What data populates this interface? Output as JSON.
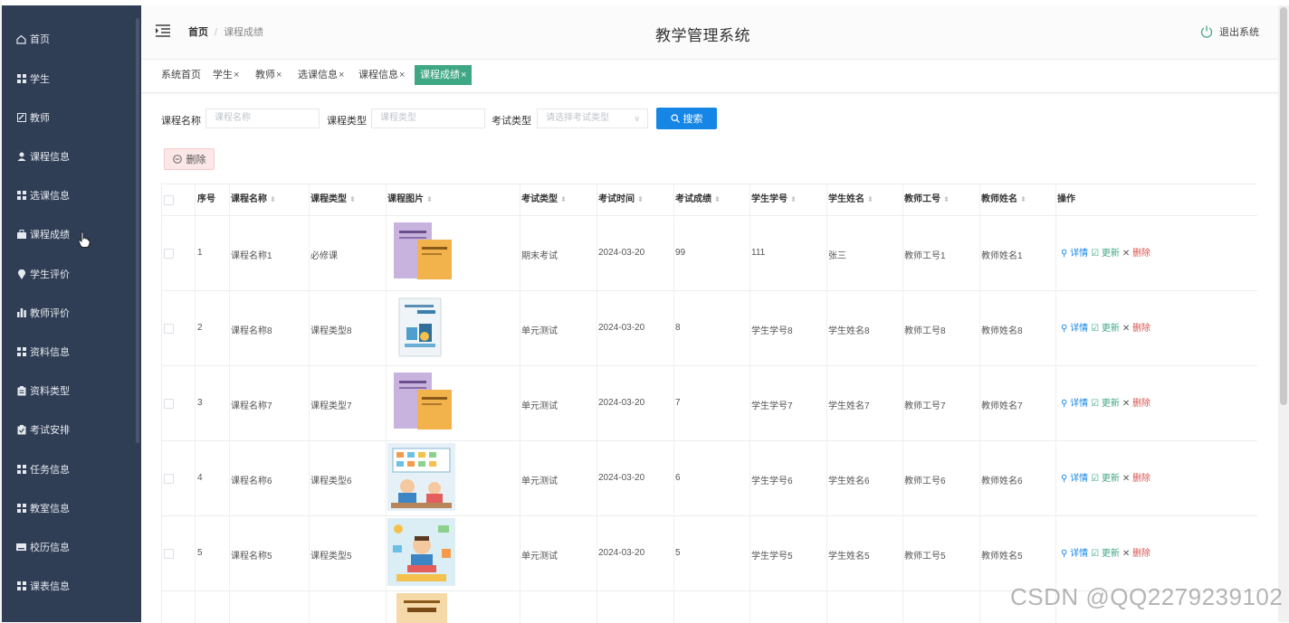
{
  "app_title": "教学管理系统",
  "logout_label": "退出系统",
  "breadcrumb": {
    "home": "首页",
    "current": "课程成绩"
  },
  "sidebar": {
    "items": [
      {
        "label": "首页",
        "icon": "home-icon"
      },
      {
        "label": "学生",
        "icon": "grid-icon"
      },
      {
        "label": "教师",
        "icon": "edit-icon"
      },
      {
        "label": "课程信息",
        "icon": "user-icon"
      },
      {
        "label": "选课信息",
        "icon": "grid-icon"
      },
      {
        "label": "课程成绩",
        "icon": "briefcase-icon"
      },
      {
        "label": "学生评价",
        "icon": "location-icon"
      },
      {
        "label": "教师评价",
        "icon": "bar-chart-icon"
      },
      {
        "label": "资料信息",
        "icon": "grid-icon"
      },
      {
        "label": "资料类型",
        "icon": "clipboard-icon"
      },
      {
        "label": "考试安排",
        "icon": "clipboard-check-icon"
      },
      {
        "label": "任务信息",
        "icon": "grid-icon"
      },
      {
        "label": "教室信息",
        "icon": "grid-icon"
      },
      {
        "label": "校历信息",
        "icon": "keyboard-icon"
      },
      {
        "label": "课表信息",
        "icon": "grid-icon"
      }
    ]
  },
  "tags": [
    {
      "label": "系统首页",
      "closable": false
    },
    {
      "label": "学生",
      "closable": true
    },
    {
      "label": "教师",
      "closable": true
    },
    {
      "label": "选课信息",
      "closable": true
    },
    {
      "label": "课程信息",
      "closable": true
    },
    {
      "label": "课程成绩",
      "closable": true,
      "active": true
    }
  ],
  "tag_close": "×",
  "search": {
    "course_name_label": "课程名称",
    "course_name_placeholder": "课程名称",
    "course_type_label": "课程类型",
    "course_type_placeholder": "课程类型",
    "exam_type_label": "考试类型",
    "exam_type_placeholder": "请选择考试类型",
    "search_button": "搜索"
  },
  "delete_button": "删除",
  "table": {
    "headers": [
      "序号",
      "课程名称",
      "课程类型",
      "课程图片",
      "考试类型",
      "考试时间",
      "考试成绩",
      "学生学号",
      "学生姓名",
      "教师工号",
      "教师姓名",
      "操作"
    ],
    "rows": [
      {
        "index": "1",
        "course_name": "课程名称1",
        "course_type": "必修课",
        "exam_type": "期末考试",
        "exam_time": "2024-03-20",
        "score": "99",
        "student_no": "111",
        "student_name": "张三",
        "teacher_no": "教师工号1",
        "teacher_name": "教师姓名1",
        "image": "book-cover-purple"
      },
      {
        "index": "2",
        "course_name": "课程名称8",
        "course_type": "课程类型8",
        "exam_type": "单元测试",
        "exam_time": "2024-03-20",
        "score": "8",
        "student_no": "学生学号8",
        "student_name": "学生姓名8",
        "teacher_no": "教师工号8",
        "teacher_name": "教师姓名8",
        "image": "book-cover-teal"
      },
      {
        "index": "3",
        "course_name": "课程名称7",
        "course_type": "课程类型7",
        "exam_type": "单元测试",
        "exam_time": "2024-03-20",
        "score": "7",
        "student_no": "学生学号7",
        "student_name": "学生姓名7",
        "teacher_no": "教师工号7",
        "teacher_name": "教师姓名7",
        "image": "book-cover-purple"
      },
      {
        "index": "4",
        "course_name": "课程名称6",
        "course_type": "课程类型6",
        "exam_type": "单元测试",
        "exam_time": "2024-03-20",
        "score": "6",
        "student_no": "学生学号6",
        "student_name": "学生姓名6",
        "teacher_no": "教师工号6",
        "teacher_name": "教师姓名6",
        "image": "classroom-illustration"
      },
      {
        "index": "5",
        "course_name": "课程名称5",
        "course_type": "课程类型5",
        "exam_type": "单元测试",
        "exam_time": "2024-03-20",
        "score": "5",
        "student_no": "学生学号5",
        "student_name": "学生姓名5",
        "teacher_no": "教师工号5",
        "teacher_name": "教师姓名5",
        "image": "reading-illustration"
      }
    ],
    "actions": {
      "detail": "详情",
      "update": "更新",
      "delete": "删除"
    }
  },
  "watermark": "CSDN @QQ2279239102",
  "colors": {
    "sidebar_bg": "#2f3d55",
    "active_tag": "#3ea784",
    "primary": "#1686e6",
    "danger": "#d9534f"
  }
}
